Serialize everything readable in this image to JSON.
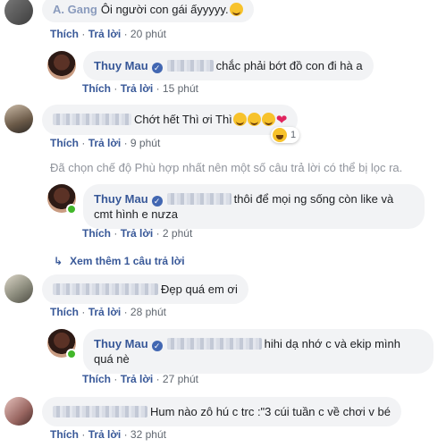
{
  "actions": {
    "like": "Thích",
    "reply": "Trả lời",
    "sep": "·"
  },
  "comments": [
    {
      "author": "A. Gang",
      "text": "Ôi người con gái ấyyyyy.",
      "time": "20 phút"
    },
    {
      "author": "Thuy Mau",
      "text": "chắc phải bớt đồ con đi hà a",
      "time": "15 phút"
    },
    {
      "text": "Chớt hết Thì ơi Thì",
      "time": "9 phút",
      "reaction_count": "1"
    },
    {
      "author": "Thuy Mau",
      "text_line1": "thôi để mọi ng sống còn like và",
      "text_line2": "cmt hình e nưza",
      "time": "2 phút"
    },
    {
      "text": "Đẹp quá em ơi",
      "time": "28 phút"
    },
    {
      "author": "Thuy Mau",
      "text_line1": "hihi dạ nhớ c và ekip mình",
      "text_line2": "quá nè",
      "time": "27 phút"
    },
    {
      "text": "Hum nào zô hú c trc :\"3 cúi tuần c về chơi v bé",
      "time": "32 phút"
    }
  ],
  "filter_notice": "Đã chọn chế độ Phù hợp nhất nên một số câu trả lời có thể bị lọc ra.",
  "view_more": "Xem thêm 1 câu trả lời",
  "colors": {
    "link": "#385898",
    "bubble": "#f2f3f5",
    "meta": "#606770",
    "online": "#42b72a"
  }
}
